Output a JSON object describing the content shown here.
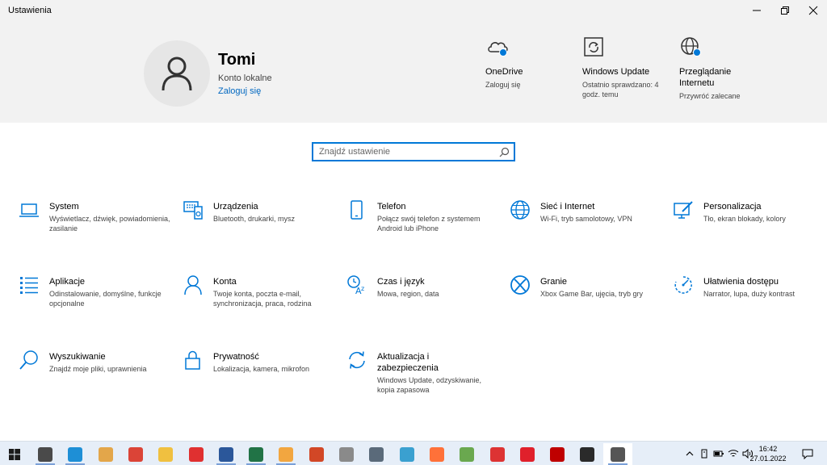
{
  "window": {
    "title": "Ustawienia"
  },
  "profile": {
    "name": "Tomi",
    "account_type": "Konto lokalne",
    "sign_in_link": "Zaloguj się"
  },
  "quick_links": [
    {
      "title": "OneDrive",
      "subtitle": "Zaloguj się",
      "icon": "cloud-icon"
    },
    {
      "title": "Windows Update",
      "subtitle": "Ostatnio sprawdzano: 4 godz. temu",
      "icon": "update-icon"
    },
    {
      "title": "Przeglądanie Internetu",
      "subtitle": "Przywróć zalecane",
      "icon": "globe-icon"
    }
  ],
  "search": {
    "placeholder": "Znajdź ustawienie"
  },
  "categories": [
    {
      "title": "System",
      "description": "Wyświetlacz, dźwięk, powiadomienia, zasilanie",
      "icon": "laptop-icon"
    },
    {
      "title": "Urządzenia",
      "description": "Bluetooth, drukarki, mysz",
      "icon": "devices-icon"
    },
    {
      "title": "Telefon",
      "description": "Połącz swój telefon z systemem Android lub iPhone",
      "icon": "phone-icon"
    },
    {
      "title": "Sieć i Internet",
      "description": "Wi-Fi, tryb samolotowy, VPN",
      "icon": "globe-icon"
    },
    {
      "title": "Personalizacja",
      "description": "Tło, ekran blokady, kolory",
      "icon": "personalization-icon"
    },
    {
      "title": "Aplikacje",
      "description": "Odinstalowanie, domyślne, funkcje opcjonalne",
      "icon": "apps-list-icon"
    },
    {
      "title": "Konta",
      "description": "Twoje konta, poczta e-mail, synchronizacja, praca, rodzina",
      "icon": "person-icon"
    },
    {
      "title": "Czas i język",
      "description": "Mowa, region, data",
      "icon": "time-language-icon"
    },
    {
      "title": "Granie",
      "description": "Xbox Game Bar, ujęcia, tryb gry",
      "icon": "xbox-icon"
    },
    {
      "title": "Ułatwienia dostępu",
      "description": "Narrator, lupa, duży kontrast",
      "icon": "accessibility-icon"
    },
    {
      "title": "Wyszukiwanie",
      "description": "Znajdź moje pliki, uprawnienia",
      "icon": "search-icon"
    },
    {
      "title": "Prywatność",
      "description": "Lokalizacja, kamera, mikrofon",
      "icon": "lock-icon"
    },
    {
      "title": "Aktualizacja i zabezpieczenia",
      "description": "Windows Update, odzyskiwanie, kopia zapasowa",
      "icon": "sync-icon"
    }
  ],
  "taskbar": {
    "apps": [
      {
        "name": "app-obs-icon",
        "color": "#4a4a4a"
      },
      {
        "name": "app-edge-icon",
        "color": "#1e8fd6"
      },
      {
        "name": "app-media-icon",
        "color": "#e3a64a"
      },
      {
        "name": "app-chrome-icon",
        "color": "#db4437"
      },
      {
        "name": "app-explorer-icon",
        "color": "#f0c040"
      },
      {
        "name": "app-mf-icon",
        "color": "#e03030"
      },
      {
        "name": "app-word-icon",
        "color": "#2b579a"
      },
      {
        "name": "app-excel-icon",
        "color": "#217346"
      },
      {
        "name": "app-outlook-icon",
        "color": "#f2a640"
      },
      {
        "name": "app-powerpoint-icon",
        "color": "#d24726"
      },
      {
        "name": "app-tool-icon",
        "color": "#8a8a8a"
      },
      {
        "name": "app-calculator-icon",
        "color": "#5a6a7a"
      },
      {
        "name": "app-paint-icon",
        "color": "#3aa0d0"
      },
      {
        "name": "app-firefox-icon",
        "color": "#ff7139"
      },
      {
        "name": "app-editor-icon",
        "color": "#6aa84f"
      },
      {
        "name": "app-red-icon",
        "color": "#d33"
      },
      {
        "name": "app-opera-icon",
        "color": "#e0202b"
      },
      {
        "name": "app-filezilla-icon",
        "color": "#bf0000"
      },
      {
        "name": "app-obs-studio-icon",
        "color": "#2a2a2a"
      },
      {
        "name": "app-settings-icon",
        "color": "#555555"
      }
    ],
    "time": "16:42",
    "date": "27.01.2022"
  }
}
